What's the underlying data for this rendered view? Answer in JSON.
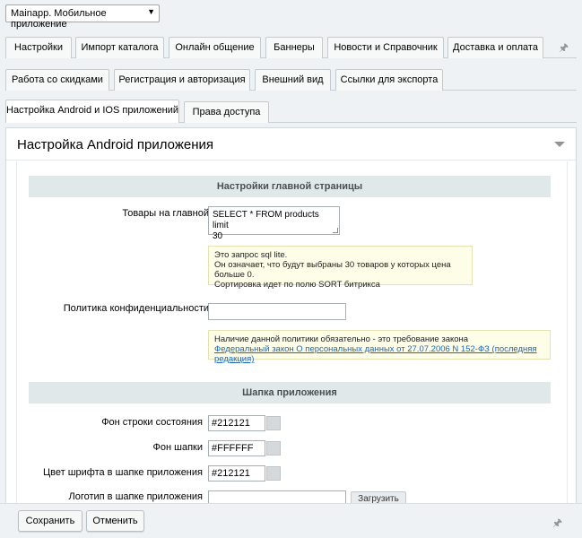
{
  "site_selector": {
    "value": "Mainapp. Мобильное приложение"
  },
  "tabs_row1": [
    {
      "label": "Настройки"
    },
    {
      "label": "Импорт каталога"
    },
    {
      "label": "Онлайн общение"
    },
    {
      "label": "Баннеры"
    },
    {
      "label": "Новости и Справочник"
    },
    {
      "label": "Доставка и оплата"
    }
  ],
  "tabs_row2": [
    {
      "label": "Работа со скидками"
    },
    {
      "label": "Регистрация и авторизация"
    },
    {
      "label": "Внешний вид"
    },
    {
      "label": "Ссылки для экспорта"
    }
  ],
  "tabs_row3": [
    {
      "label": "Настройка Android и IOS приложений"
    },
    {
      "label": "Права доступа"
    }
  ],
  "panel": {
    "title": "Настройка Android приложения"
  },
  "section_main": {
    "title": "Настройки главной страницы"
  },
  "products_field": {
    "label": "Товары на главной",
    "value_line1": "SELECT * FROM products limit",
    "value_line2": "30"
  },
  "products_hint": {
    "line1": "Это запрос sql lite.",
    "line2": "Он означает, что будут выбраны 30 товаров у которых цена больше 0.",
    "line3": "Сортировка идет по полю SORT битрикса"
  },
  "privacy_field": {
    "label": "Политика конфиденциальности",
    "value": ""
  },
  "privacy_hint": {
    "line1": "Наличие данной политики обязательно - это требование закона",
    "link": "Федеральный закон О персональных данных от 27.07.2006 N 152-ФЗ (последняя редакция)"
  },
  "section_header": {
    "title": "Шапка приложения"
  },
  "status_bar_color": {
    "label": "Фон строки состояния",
    "value": "#212121"
  },
  "header_bg_color": {
    "label": "Фон шапки",
    "value": "#FFFFFF"
  },
  "header_font_color": {
    "label": "Цвет шрифта в шапке приложения",
    "value": "#212121"
  },
  "header_logo": {
    "label": "Логотип в шапке приложения",
    "upload_label": "Загрузить"
  },
  "footer": {
    "save_label": "Сохранить",
    "cancel_label": "Отменить"
  }
}
